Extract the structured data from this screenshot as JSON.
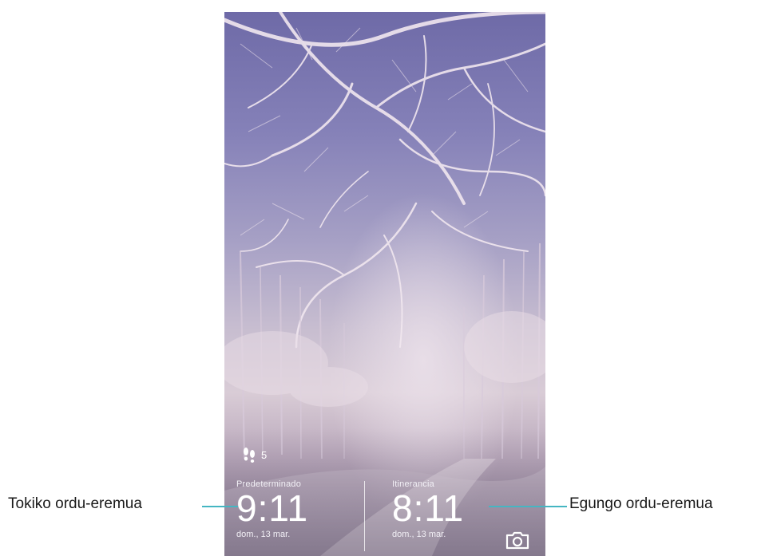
{
  "lockscreen": {
    "steps": {
      "icon": "footsteps-icon",
      "count": "5"
    },
    "clocks": [
      {
        "label": "Predeterminado",
        "time": "9:11",
        "date": "dom., 13 mar."
      },
      {
        "label": "Itinerancia",
        "time": "8:11",
        "date": "dom., 13 mar."
      }
    ],
    "camera_shortcut": {
      "icon": "camera-icon"
    }
  },
  "callouts": {
    "left": "Tokiko ordu-eremua",
    "right": "Egungo ordu-eremua"
  },
  "colors": {
    "callout_line": "#45b6c2",
    "text_on_wallpaper": "#ffffff"
  }
}
